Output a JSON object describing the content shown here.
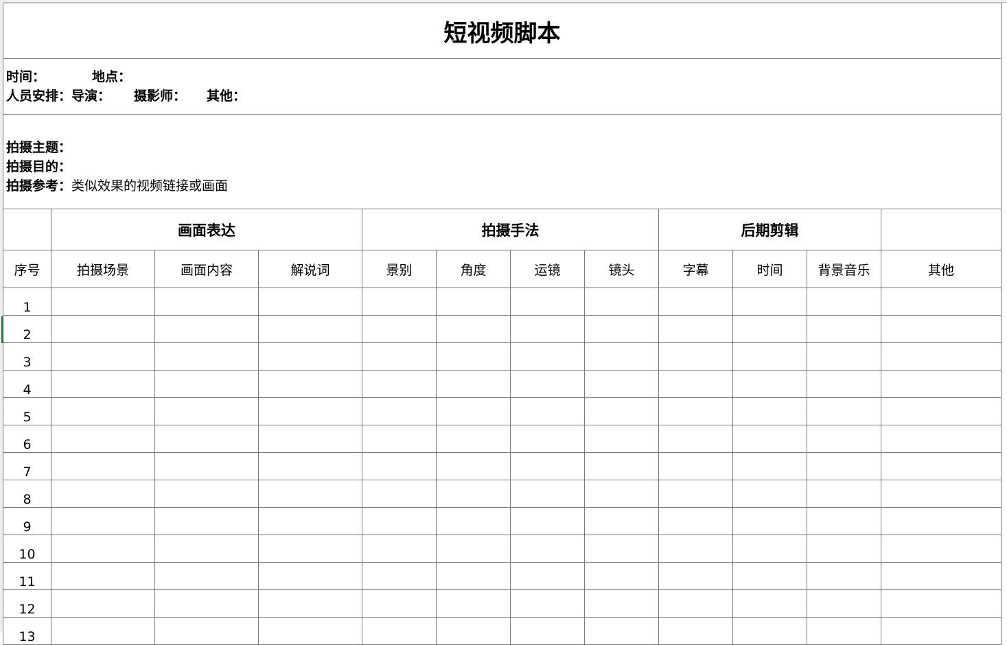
{
  "title": "短视频脚本",
  "info": {
    "time_label": "时间：",
    "place_label": "地点：",
    "staff_label": "人员安排：",
    "director_label": "导演：",
    "camera_label": "摄影师：",
    "other_label": "其他：",
    "theme_label": "拍摄主题：",
    "purpose_label": "拍摄目的：",
    "reference_label": "拍摄参考：",
    "reference_value": "类似效果的视频链接或画面"
  },
  "groups": [
    "画面表达",
    "拍摄手法",
    "后期剪辑"
  ],
  "columns": [
    "序号",
    "拍摄场景",
    "画面内容",
    "解说词",
    "景别",
    "角度",
    "运镜",
    "镜头",
    "字幕",
    "时间",
    "背景音乐",
    "其他"
  ],
  "rows": [
    "1",
    "2",
    "3",
    "4",
    "5",
    "6",
    "7",
    "8",
    "9",
    "10",
    "11",
    "12",
    "13"
  ]
}
